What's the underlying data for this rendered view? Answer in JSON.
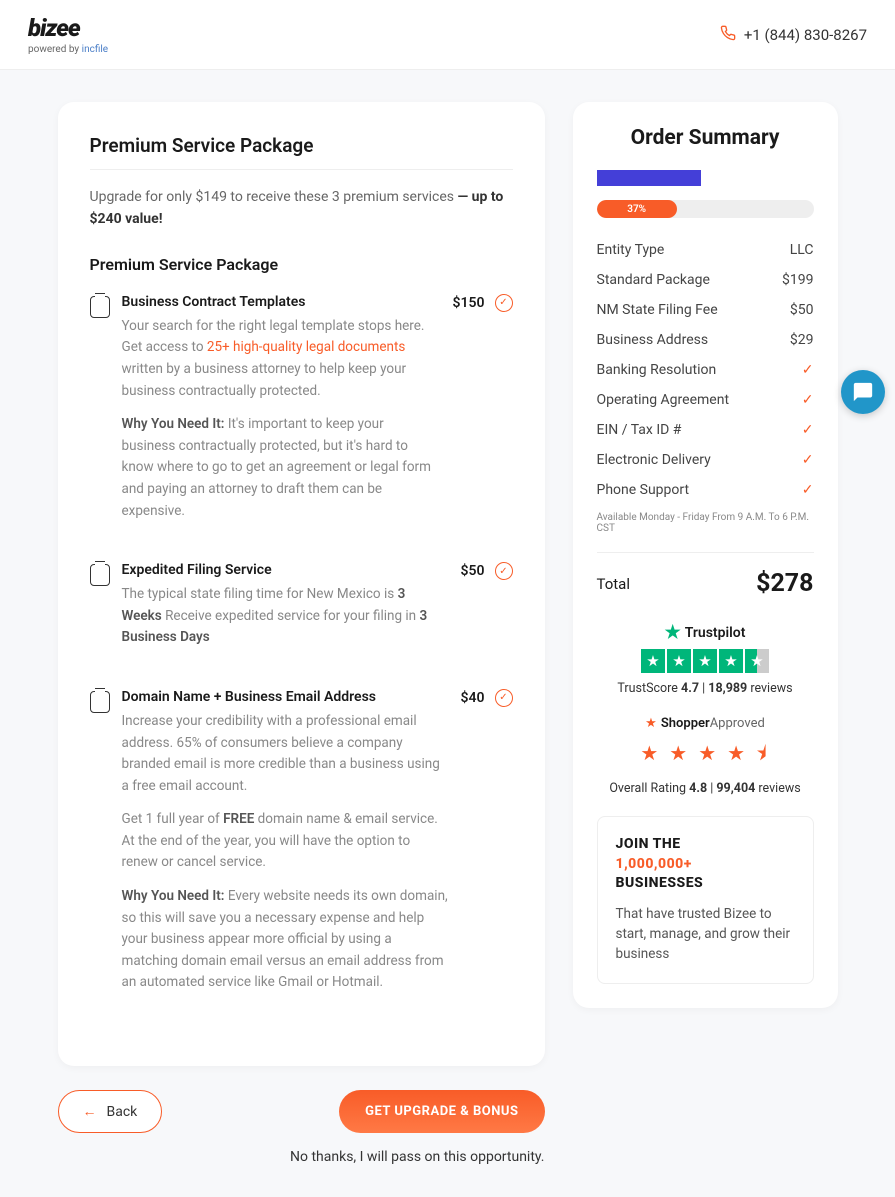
{
  "header": {
    "logo": "bizee",
    "logo_sub_prefix": "powered by ",
    "logo_sub_brand": "incfile",
    "phone": "+1 (844) 830-8267"
  },
  "package": {
    "title": "Premium Service Package",
    "intro_text": "Upgrade for only $149 to receive these 3 premium services ",
    "intro_bold": "— up to $240 value!",
    "subheading": "Premium Service Package",
    "services": [
      {
        "title": "Business Contract Templates",
        "desc1_a": "Your search for the right legal template stops here. Get access to ",
        "desc1_link": "25+ high-quality legal documents",
        "desc1_b": " written by a business attorney to help keep your business contractually protected.",
        "why_label": "Why You Need It: ",
        "why_text": "It's important to keep your business contractually protected, but it's hard to know where to go to get an agreement or legal form and paying an attorney to draft them can be expensive.",
        "price": "$150"
      },
      {
        "title": "Expedited Filing Service",
        "desc1_a": "The typical state filing time for New Mexico is ",
        "desc1_bold1": "3 Weeks",
        "desc1_b": " Receive expedited service for your filing in ",
        "desc1_bold2": "3 Business Days",
        "price": "$50"
      },
      {
        "title": "Domain Name + Business Email Address",
        "desc1": "Increase your credibility with a professional email address. 65% of consumers believe a company branded email is more credible than a business using a free email account.",
        "desc2_a": "Get 1 full year of ",
        "desc2_bold": "FREE",
        "desc2_b": " domain name & email service. At the end of the year, you will have the option to renew or cancel service.",
        "why_label": "Why You Need It: ",
        "why_text": "Every website needs its own domain, so this will save you a necessary expense and help your business appear more official by using a matching domain email versus an email address from an automated service like Gmail or Hotmail.",
        "price": "$40"
      }
    ]
  },
  "actions": {
    "back": "Back",
    "upgrade": "GET UPGRADE & BONUS",
    "nothanks": "No thanks, I will pass on this opportunity."
  },
  "summary": {
    "title": "Order Summary",
    "progress": "37%",
    "lines": [
      {
        "label": "Entity Type",
        "value": "LLC"
      },
      {
        "label": "Standard Package",
        "value": "$199"
      },
      {
        "label": "NM State Filing Fee",
        "value": "$50"
      },
      {
        "label": "Business Address",
        "value": "$29"
      },
      {
        "label": "Banking Resolution",
        "check": true
      },
      {
        "label": "Operating Agreement",
        "check": true
      },
      {
        "label": "EIN / Tax ID #",
        "check": true
      },
      {
        "label": "Electronic Delivery",
        "check": true
      },
      {
        "label": "Phone Support",
        "check": true
      }
    ],
    "availability": "Available Monday - Friday From 9 A.M. To 6 P.M. CST",
    "total_label": "Total",
    "total_value": "$278"
  },
  "trustpilot": {
    "name": "Trustpilot",
    "score_label": "TrustScore ",
    "score": "4.7",
    "sep": " | ",
    "reviews_count": "18,989",
    "reviews_label": " reviews"
  },
  "shopper": {
    "name1": "Shopper",
    "name2": "Approved",
    "rating_label": "Overall Rating ",
    "rating": "4.8",
    "sep": " | ",
    "reviews_count": "99,404",
    "reviews_label": " reviews"
  },
  "join": {
    "line1": "JOIN THE",
    "line2": "1,000,000+",
    "line3": "BUSINESSES",
    "sub": "That have trusted Bizee to start, manage, and grow their business"
  }
}
